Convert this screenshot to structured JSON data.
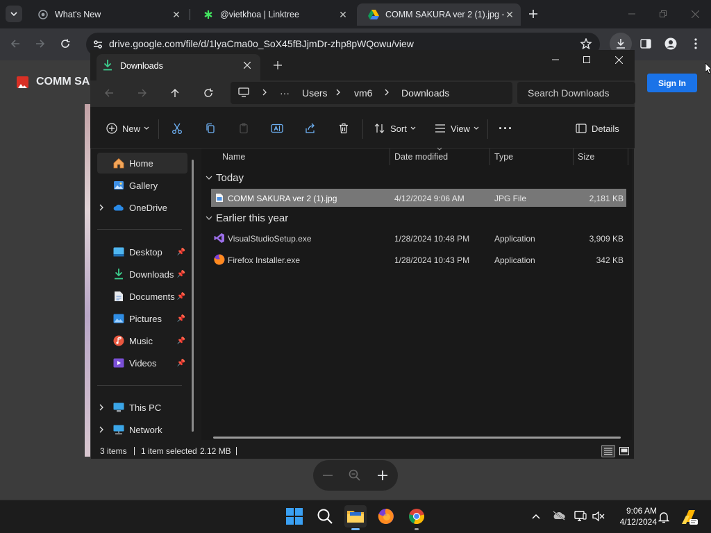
{
  "browser": {
    "tabs": [
      {
        "label": "What's New",
        "icon": "chrome-icon"
      },
      {
        "label": "@vietkhoa | Linktree",
        "icon": "linktree-icon"
      },
      {
        "label": "COMM SAKURA ver 2 (1).jpg -",
        "icon": "drive-icon"
      }
    ],
    "url": "drive.google.com/file/d/1lyaCma0o_SoX45fBJjmDr-zhp8pWQowu/view"
  },
  "drive": {
    "file_title": "COMM SA",
    "sign_in_label": "Sign In"
  },
  "explorer": {
    "tab_title": "Downloads",
    "breadcrumbs": [
      "Users",
      "vm6",
      "Downloads"
    ],
    "more_crumbs": "···",
    "search_placeholder": "Search Downloads",
    "commands": {
      "new": "New",
      "sort": "Sort",
      "view": "View",
      "details": "Details",
      "more": "···"
    },
    "sidebar": {
      "home": "Home",
      "gallery": "Gallery",
      "onedrive": "OneDrive",
      "desktop": "Desktop",
      "downloads": "Downloads",
      "documents": "Documents",
      "pictures": "Pictures",
      "music": "Music",
      "videos": "Videos",
      "this_pc": "This PC",
      "network": "Network"
    },
    "columns": {
      "name": "Name",
      "date": "Date modified",
      "type": "Type",
      "size": "Size"
    },
    "groups": {
      "today": {
        "label": "Today",
        "files": [
          {
            "name": "COMM SAKURA ver 2 (1).jpg",
            "date": "4/12/2024 9:06 AM",
            "type": "JPG File",
            "size": "2,181 KB"
          }
        ]
      },
      "earlier": {
        "label": "Earlier this year",
        "files": [
          {
            "name": "VisualStudioSetup.exe",
            "date": "1/28/2024 10:48 PM",
            "type": "Application",
            "size": "3,909 KB"
          },
          {
            "name": "Firefox Installer.exe",
            "date": "1/28/2024 10:43 PM",
            "type": "Application",
            "size": "342 KB"
          }
        ]
      }
    },
    "status": {
      "count": "3 items",
      "selection": "1 item selected",
      "size": "2.12 MB"
    }
  },
  "taskbar": {
    "time": "9:06 AM",
    "date": "4/12/2024"
  },
  "colors": {
    "accent": "#1a73e8",
    "folder_accent": "#6fb3f7",
    "selection": "#777777"
  }
}
